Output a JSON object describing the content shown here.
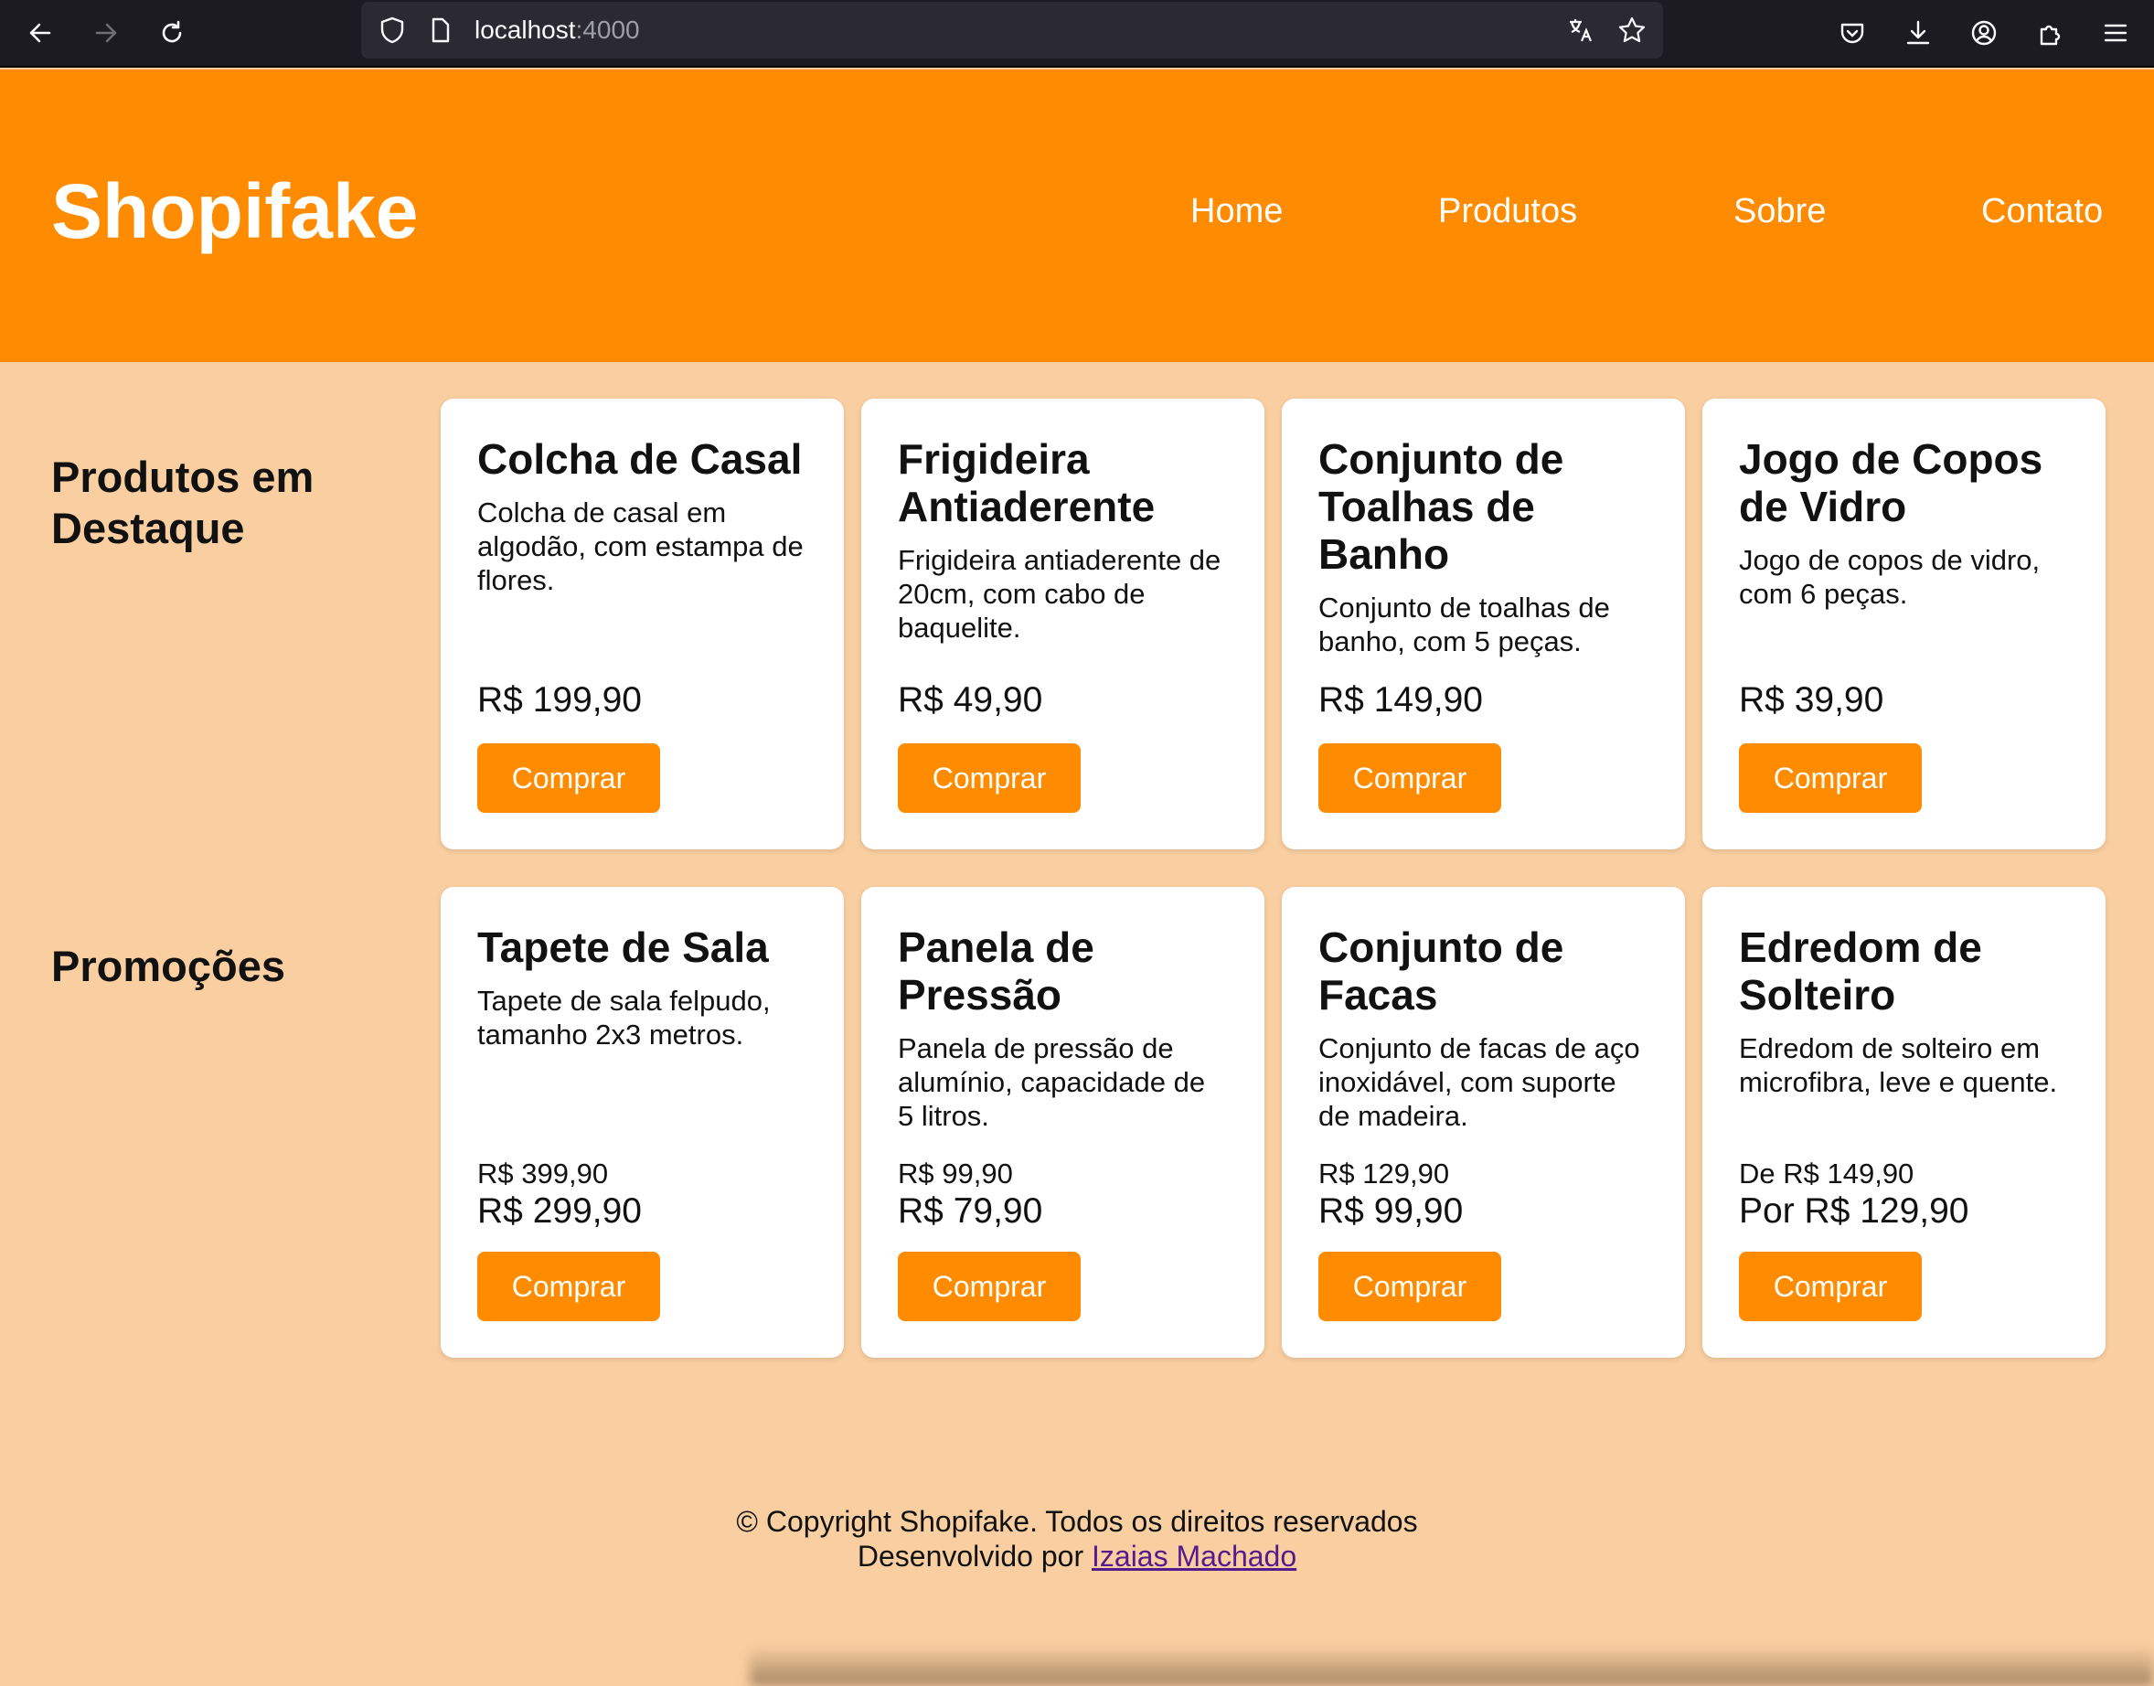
{
  "browser": {
    "url_host": "localhost",
    "url_port": ":4000",
    "icons": [
      "back-icon",
      "forward-icon",
      "reload-icon",
      "shield-icon",
      "page-icon",
      "translate-icon",
      "star-icon",
      "pocket-icon",
      "download-icon",
      "account-icon",
      "extensions-icon",
      "menu-icon"
    ]
  },
  "header": {
    "brand": "Shopifake",
    "nav": [
      "Home",
      "Produtos",
      "Sobre",
      "Contato"
    ],
    "color": "#ff8c00"
  },
  "featured": {
    "title": "Produtos em Destaque",
    "products": [
      {
        "name": "Colcha de Casal",
        "desc": "Colcha de casal em algodão, com estampa de flores.",
        "price": "R$ 199,90",
        "button": "Comprar"
      },
      {
        "name": "Frigideira Antiaderente",
        "desc": "Frigideira antiaderente de 20cm, com cabo de baquelite.",
        "price": "R$ 49,90",
        "button": "Comprar"
      },
      {
        "name": "Conjunto de Toalhas de Banho",
        "desc": "Conjunto de toalhas de banho, com 5 peças.",
        "price": "R$ 149,90",
        "button": "Comprar"
      },
      {
        "name": "Jogo de Copos de Vidro",
        "desc": "Jogo de copos de vidro, com 6 peças.",
        "price": "R$ 39,90",
        "button": "Comprar"
      }
    ]
  },
  "promotions": {
    "title": "Promoções",
    "products": [
      {
        "name": "Tapete de Sala",
        "desc": "Tapete de sala felpudo, tamanho 2x3 metros.",
        "old_price": "R$ 399,90",
        "price": "R$ 299,90",
        "button": "Comprar"
      },
      {
        "name": "Panela de Pressão",
        "desc": "Panela de pressão de alumínio, capacidade de 5 litros.",
        "old_price": "R$ 99,90",
        "price": "R$ 79,90",
        "button": "Comprar"
      },
      {
        "name": "Conjunto de Facas",
        "desc": "Conjunto de facas de aço inoxidável, com suporte de madeira.",
        "old_price": "R$ 129,90",
        "price": "R$ 99,90",
        "button": "Comprar"
      },
      {
        "name": "Edredom de Solteiro",
        "desc": "Edredom de solteiro em microfibra, leve e quente.",
        "old_price": "De R$ 149,90",
        "price": "Por R$ 129,90",
        "button": "Comprar"
      }
    ]
  },
  "footer": {
    "copyright": "© Copyright Shopifake. Todos os direitos reservados",
    "dev_prefix": "Desenvolvido por ",
    "dev_name": "Izaias Machado"
  }
}
